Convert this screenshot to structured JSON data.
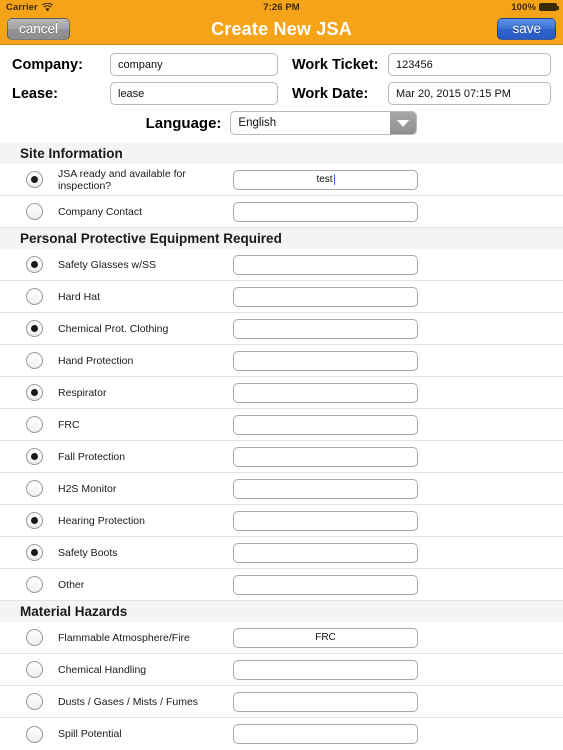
{
  "status_bar": {
    "carrier": "Carrier",
    "wifi_icon": "wifi-icon",
    "time": "7:26 PM",
    "battery_percent": "100%",
    "battery_icon": "battery-full-icon"
  },
  "nav_bar": {
    "cancel_label": "cancel",
    "title": "Create New JSA",
    "save_label": "save",
    "background_color": "#F5A318",
    "save_color": "#3b6fd4"
  },
  "form_header": {
    "company_label": "Company:",
    "company_value": "company",
    "work_ticket_label": "Work Ticket:",
    "work_ticket_value": "123456",
    "lease_label": "Lease:",
    "lease_value": "lease",
    "work_date_label": "Work Date:",
    "work_date_value": "Mar 20, 2015 07:15 PM",
    "language_label": "Language:",
    "language_value": "English",
    "dropdown_icon": "chevron-down-icon"
  },
  "sections": [
    {
      "title": "Site Information",
      "rows": [
        {
          "label": "JSA ready and available for inspection?",
          "selected": true,
          "value": "test",
          "focused": true
        },
        {
          "label": "Company Contact",
          "selected": false,
          "value": "",
          "focused": false
        }
      ]
    },
    {
      "title": "Personal Protective Equipment Required",
      "rows": [
        {
          "label": "Safety Glasses w/SS",
          "selected": true,
          "value": "",
          "focused": false
        },
        {
          "label": "Hard Hat",
          "selected": false,
          "value": "",
          "focused": false
        },
        {
          "label": "Chemical Prot. Clothing",
          "selected": true,
          "value": "",
          "focused": false
        },
        {
          "label": "Hand Protection",
          "selected": false,
          "value": "",
          "focused": false
        },
        {
          "label": "Respirator",
          "selected": true,
          "value": "",
          "focused": false
        },
        {
          "label": "FRC",
          "selected": false,
          "value": "",
          "focused": false
        },
        {
          "label": "Fall Protection",
          "selected": true,
          "value": "",
          "focused": false
        },
        {
          "label": "H2S Monitor",
          "selected": false,
          "value": "",
          "focused": false
        },
        {
          "label": "Hearing Protection",
          "selected": true,
          "value": "",
          "focused": false
        },
        {
          "label": "Safety Boots",
          "selected": true,
          "value": "",
          "focused": false
        },
        {
          "label": "Other",
          "selected": false,
          "value": "",
          "focused": false
        }
      ]
    },
    {
      "title": "Material Hazards",
      "rows": [
        {
          "label": "Flammable Atmosphere/Fire",
          "selected": false,
          "value": "FRC",
          "focused": false
        },
        {
          "label": "Chemical Handling",
          "selected": false,
          "value": "",
          "focused": false
        },
        {
          "label": "Dusts / Gases / Mists / Fumes",
          "selected": false,
          "value": "",
          "focused": false
        },
        {
          "label": "Spill Potential",
          "selected": false,
          "value": "",
          "focused": false
        }
      ]
    }
  ]
}
